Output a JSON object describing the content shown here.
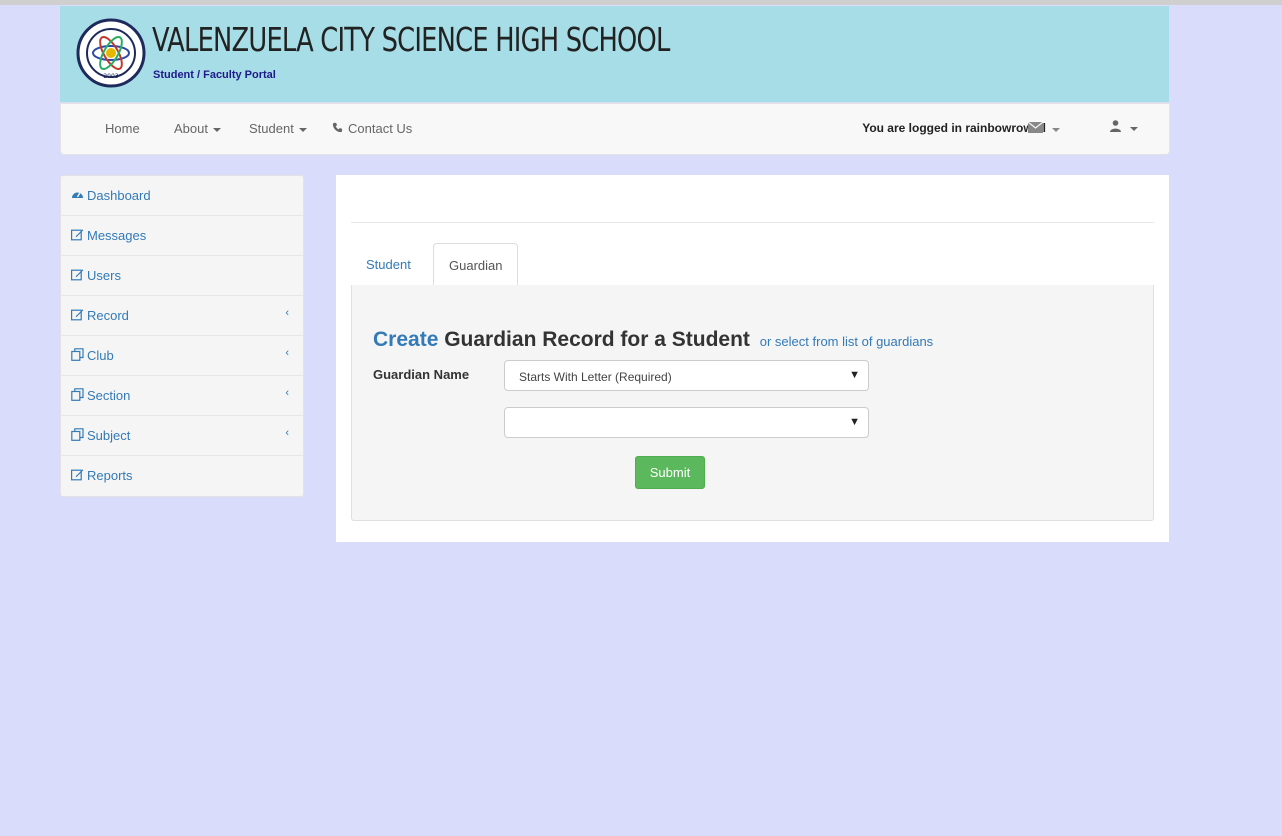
{
  "header": {
    "school_name": "VALENZUELA CITY SCIENCE HIGH SCHOOL",
    "portal_subtitle": "Student / Faculty Portal",
    "banner_color": "#a6dde6"
  },
  "navbar": {
    "items": [
      {
        "label": "Home"
      },
      {
        "label": "About"
      },
      {
        "label": "Student"
      },
      {
        "label": "Contact Us",
        "icon": "phone-icon"
      }
    ],
    "logged_in_text": "You are logged in rainbowrowell",
    "envelope_icon": "envelope-icon",
    "user_icon": "user-icon"
  },
  "sidebar": {
    "items": [
      {
        "label": "Dashboard",
        "icon": "dashboard-icon"
      },
      {
        "label": "Messages",
        "icon": "edit-icon"
      },
      {
        "label": "Users",
        "icon": "edit-icon"
      },
      {
        "label": "Record",
        "icon": "edit-icon",
        "expandable": true
      },
      {
        "label": "Club",
        "icon": "copy-icon",
        "expandable": true
      },
      {
        "label": "Section",
        "icon": "copy-icon",
        "expandable": true
      },
      {
        "label": "Subject",
        "icon": "copy-icon",
        "expandable": true
      },
      {
        "label": "Reports",
        "icon": "edit-icon"
      }
    ]
  },
  "tabs": [
    {
      "label": "Student",
      "active": false
    },
    {
      "label": "Guardian",
      "active": true
    }
  ],
  "form": {
    "heading_create": "Create",
    "heading_rest": "Guardian Record for a Student",
    "select_link": "or select from list of guardians",
    "guardian_name_label": "Guardian Name",
    "letter_select_value": "Starts With Letter (Required)",
    "name_select_value": "",
    "submit_label": "Submit"
  },
  "colors": {
    "page_background": "#d9dcfb",
    "link": "#337ab7",
    "submit": "#5cb85c"
  }
}
